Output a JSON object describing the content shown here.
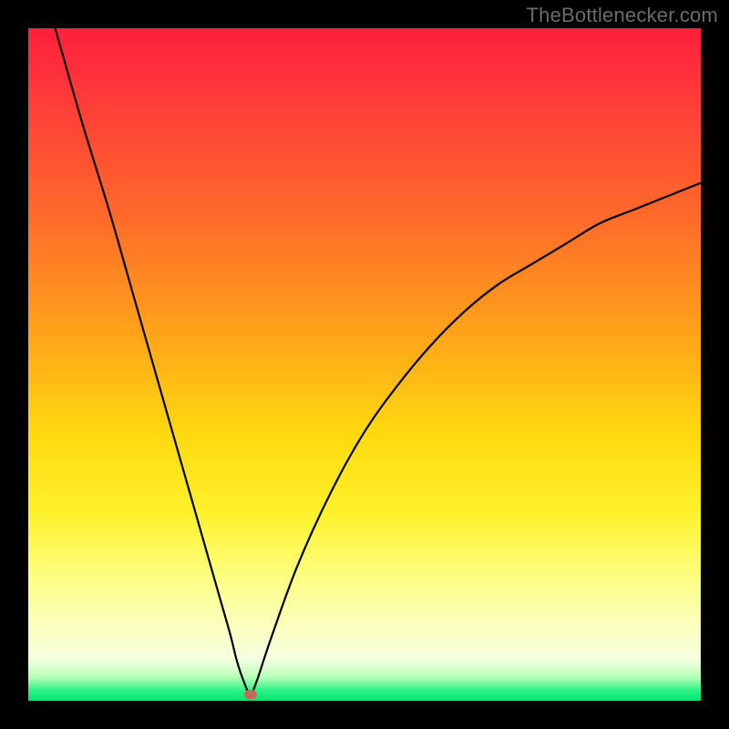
{
  "watermark": "TheBottlenecker.com",
  "colors": {
    "frame": "#000000",
    "curve": "#000000",
    "marker": "#c06a5a",
    "gradient_top": "#ff1f3d",
    "gradient_bottom": "#00e472"
  },
  "chart_data": {
    "type": "line",
    "title": "",
    "xlabel": "",
    "ylabel": "",
    "xlim": [
      0,
      100
    ],
    "ylim": [
      0,
      100
    ],
    "x_at_minimum": 33,
    "marker": {
      "x": 33,
      "y": 1
    },
    "series": [
      {
        "name": "curve",
        "x": [
          4,
          8,
          12,
          16,
          20,
          24,
          28,
          30,
          31,
          32,
          33,
          34,
          36,
          40,
          45,
          50,
          55,
          60,
          65,
          70,
          75,
          80,
          85,
          90,
          95,
          100
        ],
        "y": [
          100,
          86,
          73,
          59,
          45,
          31,
          17,
          10,
          6,
          3,
          1,
          3,
          9,
          20,
          31,
          40,
          47,
          53,
          58,
          62,
          65,
          68,
          71,
          73,
          75,
          77
        ]
      }
    ],
    "annotations": []
  }
}
